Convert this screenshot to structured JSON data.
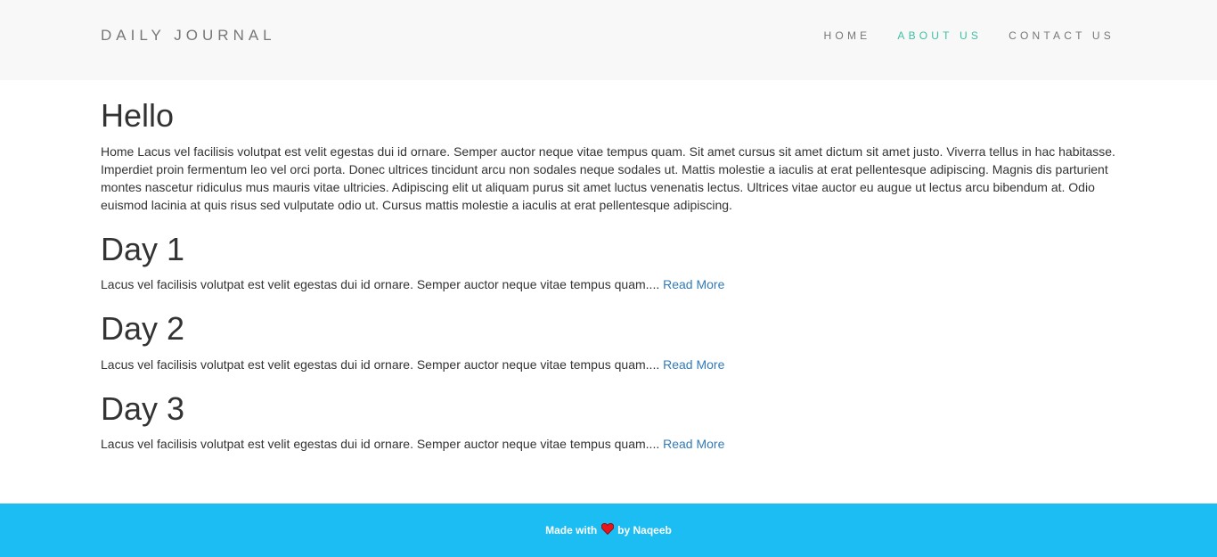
{
  "header": {
    "brand": "DAILY JOURNAL",
    "nav": [
      {
        "label": "HOME",
        "active": false
      },
      {
        "label": "ABOUT US",
        "active": true
      },
      {
        "label": "CONTACT US",
        "active": false
      }
    ]
  },
  "main": {
    "title": "Hello",
    "intro": "Home Lacus vel facilisis volutpat est velit egestas dui id ornare. Semper auctor neque vitae tempus quam. Sit amet cursus sit amet dictum sit amet justo. Viverra tellus in hac habitasse. Imperdiet proin fermentum leo vel orci porta. Donec ultrices tincidunt arcu non sodales neque sodales ut. Mattis molestie a iaculis at erat pellentesque adipiscing. Magnis dis parturient montes nascetur ridiculus mus mauris vitae ultricies. Adipiscing elit ut aliquam purus sit amet luctus venenatis lectus. Ultrices vitae auctor eu augue ut lectus arcu bibendum at. Odio euismod lacinia at quis risus sed vulputate odio ut. Cursus mattis molestie a iaculis at erat pellentesque adipiscing.",
    "posts": [
      {
        "title": "Day 1",
        "excerpt": "Lacus vel facilisis volutpat est velit egestas dui id ornare. Semper auctor neque vitae tempus quam....",
        "link": "Read More"
      },
      {
        "title": "Day 2",
        "excerpt": "Lacus vel facilisis volutpat est velit egestas dui id ornare. Semper auctor neque vitae tempus quam....",
        "link": "Read More"
      },
      {
        "title": "Day 3",
        "excerpt": "Lacus vel facilisis volutpat est velit egestas dui id ornare. Semper auctor neque vitae tempus quam....",
        "link": "Read More"
      }
    ]
  },
  "footer": {
    "made_with": "Made with",
    "by": "by Naqeeb",
    "heart_icon": "heart-icon"
  },
  "colors": {
    "nav_active": "#3ec1a2",
    "link": "#337ab7",
    "footer_bg": "#1cbdf3",
    "heart": "#e8141b"
  }
}
